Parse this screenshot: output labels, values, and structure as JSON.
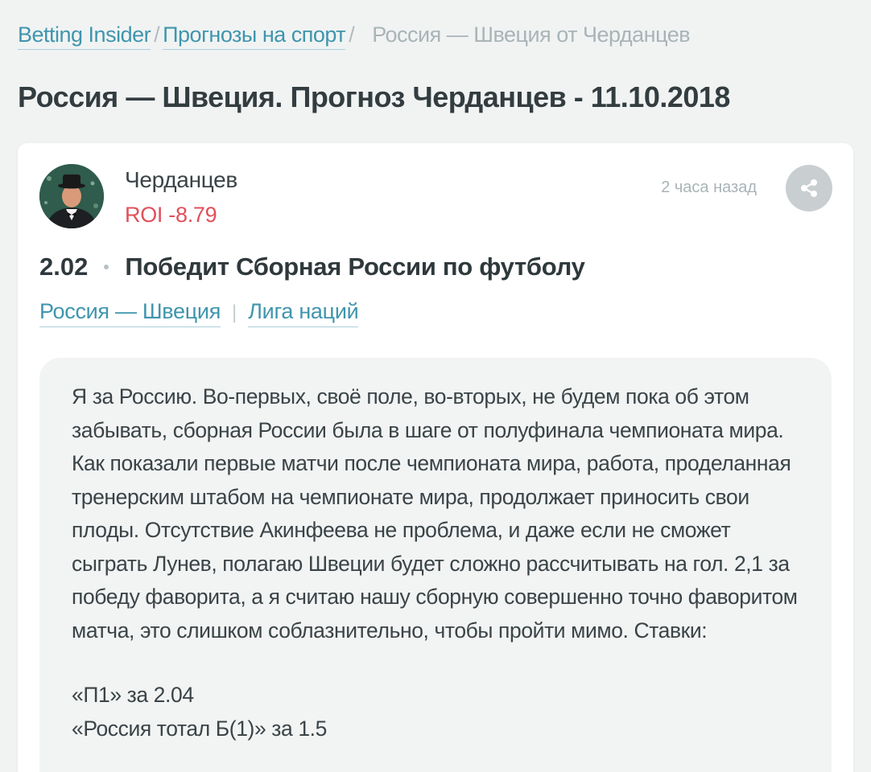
{
  "breadcrumb": {
    "items": [
      {
        "label": "Betting Insider"
      },
      {
        "label": "Прогнозы на спорт"
      }
    ],
    "separator": "/",
    "current": "Россия — Швеция от Черданцев"
  },
  "page_title": "Россия — Швеция. Прогноз Черданцев - 11.10.2018",
  "post": {
    "author": {
      "name": "Черданцев",
      "roi": "ROI -8.79"
    },
    "timestamp": "2 часа назад",
    "share_icon": "share-icon",
    "bet": {
      "odds": "2.02",
      "title": "Победит Сборная России по футболу"
    },
    "tags": [
      {
        "label": "Россия — Швеция"
      },
      {
        "label": "Лига наций"
      }
    ],
    "tag_separator": "|",
    "comment": "Я за Россию. Во-первых, своё поле, во-вторых, не будем пока об этом забывать, сборная России была в шаге от полуфинала чемпионата мира. Как показали первые матчи после чемпионата мира, работа, проделанная тренерским штабом на чемпионате мира, продолжает приносить свои плоды. Отсутствие Акинфеева не проблема, и даже если не сможет сыграть Лунев, полагаю Швеции будет сложно рассчитывать на гол. 2,1 за победу фаворита, а я считаю нашу сборную совершенно точно фаворитом матча, это слишком соблазнительно, чтобы пройти мимо. Ставки:",
    "bets": [
      "«П1» за 2.04",
      "«Россия тотал Б(1)» за 1.5"
    ]
  },
  "colors": {
    "link": "#3f95ad",
    "roi_negative": "#e0505a",
    "title": "#333d40",
    "muted": "#a9b4b7"
  }
}
